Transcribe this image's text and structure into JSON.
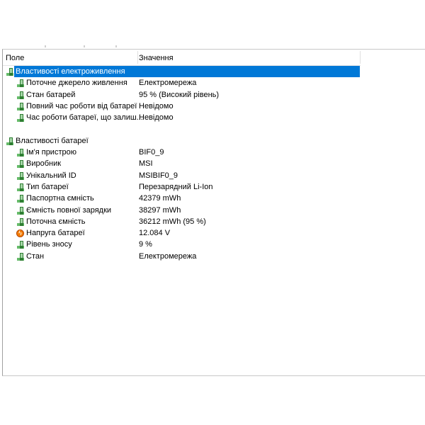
{
  "columns": {
    "field": "Поле",
    "value": "Значення"
  },
  "groups": [
    {
      "title": "Властивості електроживлення",
      "items": [
        {
          "field": "Поточне джерело живлення",
          "value": "Електромережа",
          "icon": "battery-icon"
        },
        {
          "field": "Стан батарей",
          "value": "95 % (Високий рівень)",
          "icon": "battery-icon"
        },
        {
          "field": "Повний час роботи від батареї",
          "value": "Невідомо",
          "icon": "battery-icon"
        },
        {
          "field": "Час роботи батареї, що залиш...",
          "value": "Невідомо",
          "icon": "battery-icon"
        }
      ]
    },
    {
      "title": "Властивості батареї",
      "items": [
        {
          "field": "Ім'я пристрою",
          "value": "BIF0_9",
          "icon": "battery-icon"
        },
        {
          "field": "Виробник",
          "value": "MSI",
          "icon": "battery-icon"
        },
        {
          "field": "Унікальний ID",
          "value": "MSIBIF0_9",
          "icon": "battery-icon"
        },
        {
          "field": "Тип батареї",
          "value": "Перезарядний Li-Ion",
          "icon": "battery-icon"
        },
        {
          "field": "Паспортна ємність",
          "value": "42379 mWh",
          "icon": "battery-icon"
        },
        {
          "field": "Ємність повної зарядки",
          "value": "38297 mWh",
          "icon": "battery-icon"
        },
        {
          "field": "Поточна ємність",
          "value": "36212 mWh  (95 %)",
          "icon": "battery-icon"
        },
        {
          "field": "Напруга батареї",
          "value": "12.084 V",
          "icon": "voltage-icon"
        },
        {
          "field": "Рівень зносу",
          "value": "9 %",
          "icon": "battery-icon"
        },
        {
          "field": "Стан",
          "value": "Електромережа",
          "icon": "battery-icon"
        }
      ]
    }
  ],
  "selected": "group-0",
  "colors": {
    "selection": "#0078d7",
    "battery": "#2e7d32",
    "voltage": "#f57c00"
  }
}
